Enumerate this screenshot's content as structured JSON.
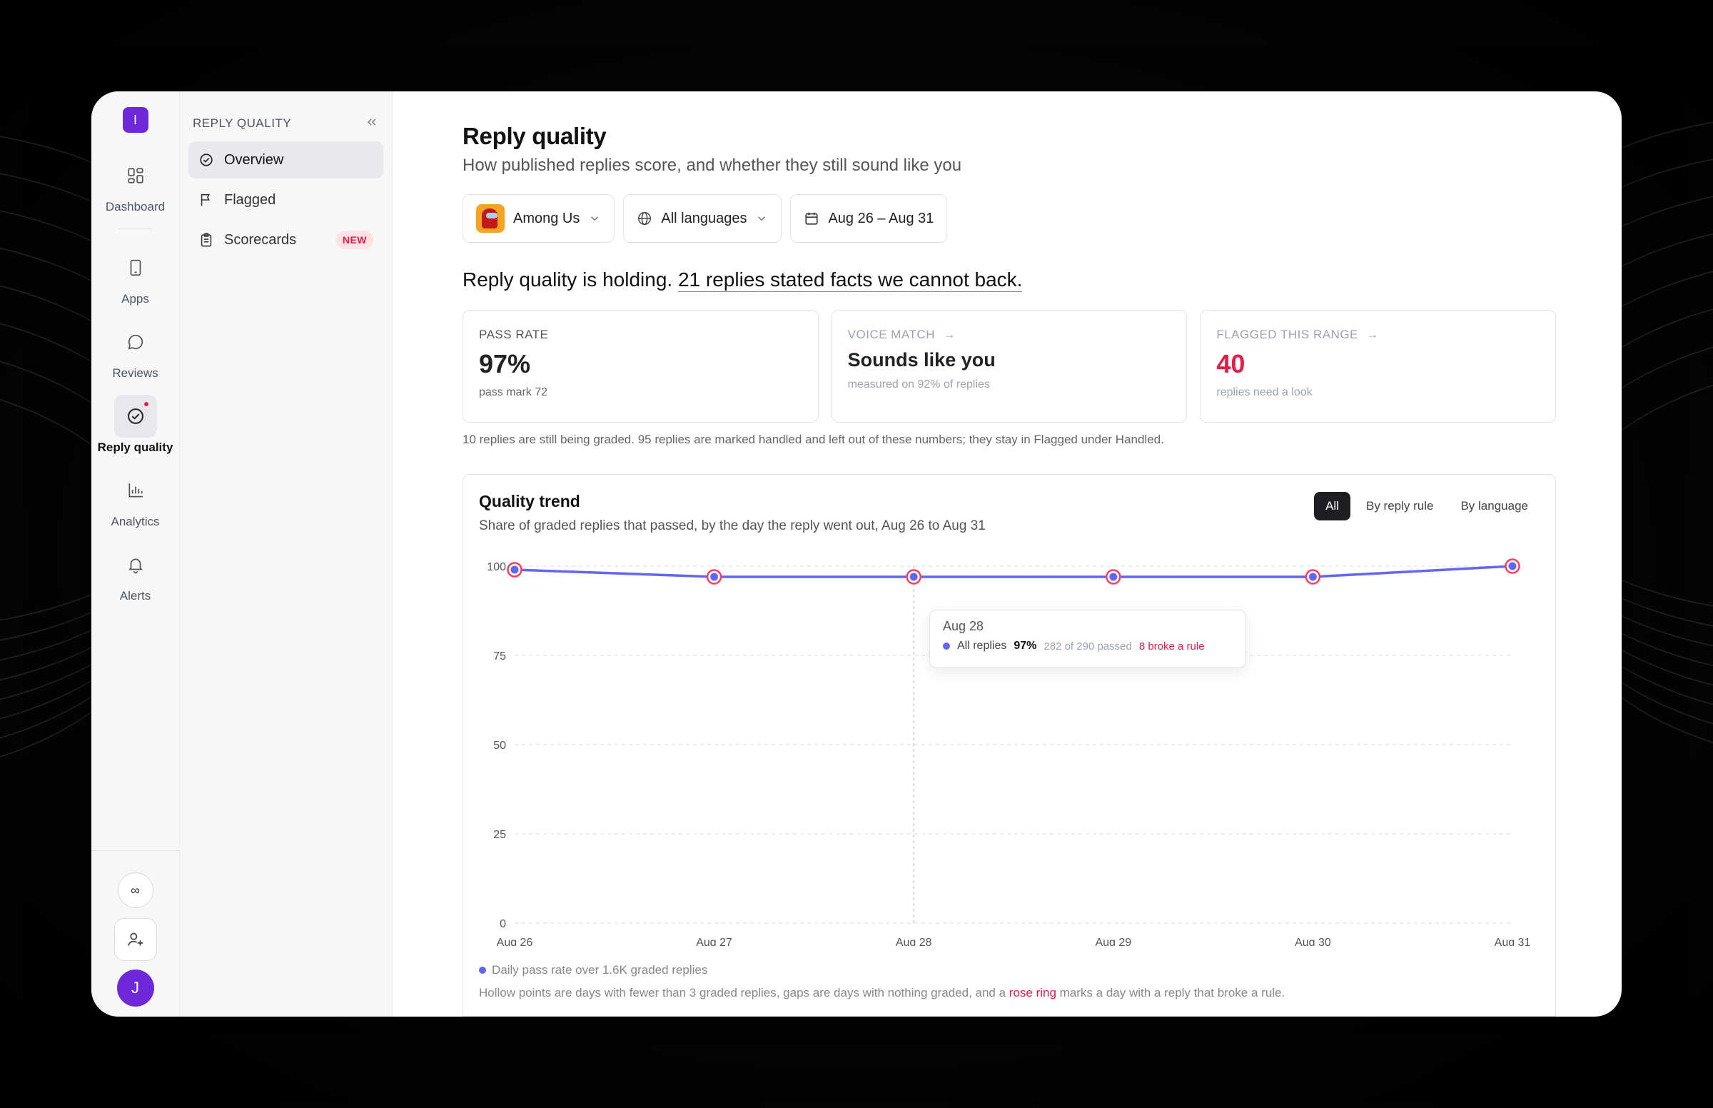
{
  "rail": {
    "logo": "I",
    "items": [
      {
        "label": "Dashboard",
        "icon": "dashboard-icon"
      },
      {
        "label": "Apps",
        "icon": "phone-icon"
      },
      {
        "label": "Reviews",
        "icon": "chat-bubble-icon"
      },
      {
        "label": "Reply quality",
        "icon": "check-circle-icon",
        "active": true,
        "notification": true
      },
      {
        "label": "Analytics",
        "icon": "bar-chart-icon"
      },
      {
        "label": "Alerts",
        "icon": "bell-icon"
      }
    ],
    "infinity": "∞",
    "avatar": "J"
  },
  "sidebar": {
    "title": "REPLY QUALITY",
    "items": [
      {
        "label": "Overview",
        "icon": "check-circle-icon",
        "active": true
      },
      {
        "label": "Flagged",
        "icon": "flag-icon"
      },
      {
        "label": "Scorecards",
        "icon": "clipboard-icon",
        "badge": "NEW"
      }
    ]
  },
  "header": {
    "title": "Reply quality",
    "subtitle": "How published replies score, and whether they still sound like you"
  },
  "filters": {
    "app": "Among Us",
    "language": "All languages",
    "date_range": "Aug 26 – Aug 31"
  },
  "headline": {
    "lead": "Reply quality is holding.",
    "link": "21 replies stated facts we cannot back."
  },
  "cards": {
    "pass_rate": {
      "label": "PASS RATE",
      "value": "97%",
      "sub": "pass mark 72"
    },
    "voice_match": {
      "label": "VOICE MATCH",
      "value": "Sounds like you",
      "sub": "measured on 92% of replies"
    },
    "flagged": {
      "label": "FLAGGED THIS RANGE",
      "value": "40",
      "sub": "replies need a look"
    }
  },
  "note": "10 replies are still being graded. 95 replies are marked handled and left out of these numbers; they stay in Flagged under Handled.",
  "trend": {
    "title": "Quality trend",
    "subtitle": "Share of graded replies that passed, by the day the reply went out, Aug 26 to Aug 31",
    "tabs": [
      "All",
      "By reply rule",
      "By language"
    ],
    "active_tab": "All",
    "legend": "Daily pass rate over 1.6K graded replies",
    "footnote_pre": "Hollow points are days with fewer than 3 graded replies, gaps are days with nothing graded, and a ",
    "footnote_rose": "rose ring",
    "footnote_post": " marks a day with a reply that broke a rule.",
    "tooltip": {
      "date": "Aug 28",
      "series": "All replies",
      "pct": "97%",
      "detail": "282 of 290 passed",
      "broke": "8 broke a rule"
    },
    "colors": {
      "line": "#6366f1",
      "rose": "#f43f5e"
    }
  },
  "chart_data": {
    "type": "line",
    "x": [
      "Aug 26",
      "Aug 27",
      "Aug 28",
      "Aug 29",
      "Aug 30",
      "Aug 31"
    ],
    "series": [
      {
        "name": "All replies",
        "values": [
          99,
          97,
          97,
          97,
          97,
          100
        ],
        "rose_ring": [
          true,
          true,
          true,
          true,
          true,
          true
        ]
      }
    ],
    "ylim": [
      0,
      100
    ],
    "yticks": [
      0,
      25,
      50,
      75,
      100
    ],
    "grid": true,
    "hover_marker": "Aug 28"
  }
}
